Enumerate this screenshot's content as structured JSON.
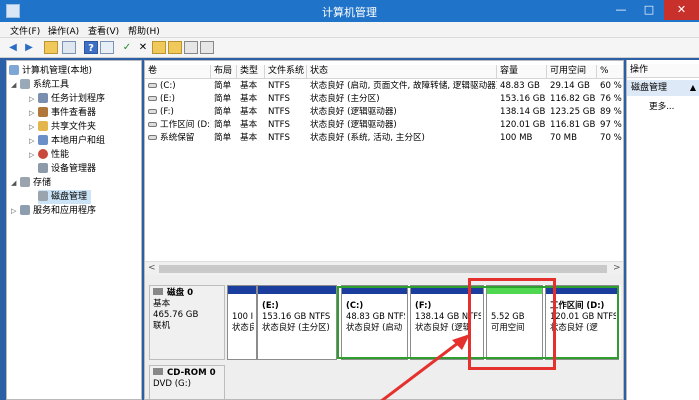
{
  "window": {
    "title": "计算机管理",
    "minimize": "—",
    "maximize": "□",
    "close": "✕"
  },
  "menu": [
    "文件(F)",
    "操作(A)",
    "查看(V)",
    "帮助(H)"
  ],
  "toolbar_icons": [
    "back-arrow-icon",
    "forward-arrow-icon",
    "up-folder-icon",
    "show-hide-tree-icon",
    "help-icon",
    "properties-icon",
    "check-icon",
    "delete-icon",
    "new-folder-icon",
    "open-folder-icon",
    "refresh-icon",
    "zoom-icon"
  ],
  "tree": [
    {
      "label": "计算机管理(本地)",
      "level": 0,
      "expander": "",
      "icon": "computer-icon"
    },
    {
      "label": "系统工具",
      "level": 1,
      "expander": "◢",
      "icon": "tools-icon"
    },
    {
      "label": "任务计划程序",
      "level": 2,
      "expander": "▷",
      "icon": "task-scheduler-icon"
    },
    {
      "label": "事件查看器",
      "level": 2,
      "expander": "▷",
      "icon": "event-viewer-icon"
    },
    {
      "label": "共享文件夹",
      "level": 2,
      "expander": "▷",
      "icon": "shared-folder-icon"
    },
    {
      "label": "本地用户和组",
      "level": 2,
      "expander": "▷",
      "icon": "users-icon"
    },
    {
      "label": "性能",
      "level": 2,
      "expander": "▷",
      "icon": "performance-icon"
    },
    {
      "label": "设备管理器",
      "level": 2,
      "expander": "",
      "icon": "device-manager-icon"
    },
    {
      "label": "存储",
      "level": 1,
      "expander": "◢",
      "icon": "storage-icon"
    },
    {
      "label": "磁盘管理",
      "level": 2,
      "expander": "",
      "icon": "disk-management-icon",
      "selected": true
    },
    {
      "label": "服务和应用程序",
      "level": 1,
      "expander": "▷",
      "icon": "services-icon"
    }
  ],
  "volume_table": {
    "headers": [
      "卷",
      "布局",
      "类型",
      "文件系统",
      "状态",
      "容量",
      "可用空间",
      "%"
    ],
    "rows": [
      [
        "(C:)",
        "简单",
        "基本",
        "NTFS",
        "状态良好 (启动, 页面文件, 故障转储, 逻辑驱动器)",
        "48.83 GB",
        "29.14 GB",
        "60 %"
      ],
      [
        "(E:)",
        "简单",
        "基本",
        "NTFS",
        "状态良好 (主分区)",
        "153.16 GB",
        "116.82 GB",
        "76 %"
      ],
      [
        "(F:)",
        "简单",
        "基本",
        "NTFS",
        "状态良好 (逻辑驱动器)",
        "138.14 GB",
        "123.25 GB",
        "89 %"
      ],
      [
        "工作区间 (D:)",
        "简单",
        "基本",
        "NTFS",
        "状态良好 (逻辑驱动器)",
        "120.01 GB",
        "116.81 GB",
        "97 %"
      ],
      [
        "系统保留",
        "简单",
        "基本",
        "NTFS",
        "状态良好 (系统, 活动, 主分区)",
        "100 MB",
        "70 MB",
        "70 %"
      ]
    ]
  },
  "scroll": {
    "left": "<",
    "right": ">"
  },
  "disks": [
    {
      "name": "磁盘 0",
      "type": "基本",
      "size": "465.76 GB",
      "status": "联机"
    },
    {
      "name": "CD-ROM 0",
      "type": "DVD (G:)",
      "size": "",
      "status": ""
    }
  ],
  "partitions": [
    {
      "title": "",
      "line1": "100 I",
      "line2": "状态良",
      "bar_color": "#1a3d9e"
    },
    {
      "title": "(E:)",
      "line1": "153.16 GB NTFS",
      "line2": "状态良好 (主分区)",
      "bar_color": "#1a3d9e"
    },
    {
      "title": "(C:)",
      "line1": "48.83 GB NTFS",
      "line2": "状态良好 (启动",
      "bar_color": "#1a3d9e"
    },
    {
      "title": "(F:)",
      "line1": "138.14 GB NTFS",
      "line2": "状态良好 (逻辑",
      "bar_color": "#1a3d9e"
    },
    {
      "title": "",
      "line1": "5.52 GB",
      "line2": "可用空间",
      "bar_color": "#4fd84f"
    },
    {
      "title": "工作区间 (D:)",
      "line1": "120.01 GB NTFS",
      "line2": "状态良好 (逻",
      "bar_color": "#1a3d9e"
    }
  ],
  "actions": {
    "header": "操作",
    "section": "磁盘管理",
    "section_caret": "▲",
    "more": "更多..."
  },
  "colors": {
    "titlebar": "#1f73c8",
    "partition_bar": "#1a3d9e",
    "free_space_bar": "#4fd84f",
    "extended_border": "#2e9e2e",
    "highlight": "#e4312d"
  }
}
